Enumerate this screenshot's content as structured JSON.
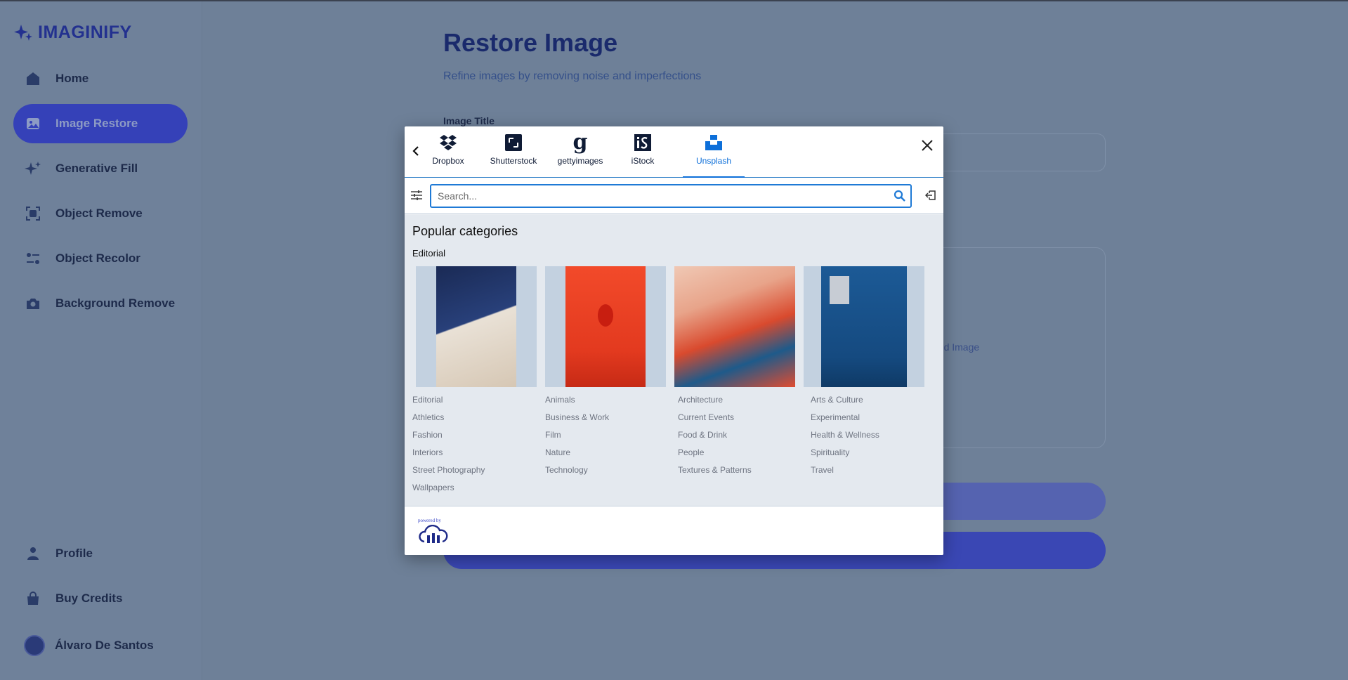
{
  "brand": {
    "name": "IMAGINIFY"
  },
  "sidebar": {
    "items": [
      {
        "label": "Home",
        "icon": "home-icon"
      },
      {
        "label": "Image Restore",
        "icon": "image-icon",
        "active": true
      },
      {
        "label": "Generative Fill",
        "icon": "sparkle-icon"
      },
      {
        "label": "Object Remove",
        "icon": "scan-icon"
      },
      {
        "label": "Object Recolor",
        "icon": "filter-icon"
      },
      {
        "label": "Background Remove",
        "icon": "camera-icon"
      }
    ],
    "bottom_items": [
      {
        "label": "Profile",
        "icon": "person-icon"
      },
      {
        "label": "Buy Credits",
        "icon": "bag-icon"
      }
    ],
    "user_name": "Álvaro De Santos"
  },
  "main": {
    "title": "Restore Image",
    "subtitle": "Refine images by removing noise and imperfections",
    "field_label": "Image Title",
    "transformed_label": "ned Image"
  },
  "modal": {
    "tabs": [
      {
        "label": "Dropbox",
        "icon": "dropbox-icon"
      },
      {
        "label": "Shutterstock",
        "icon": "shutterstock-icon"
      },
      {
        "label": "gettyimages",
        "icon": "gettyimages-icon"
      },
      {
        "label": "iStock",
        "icon": "istock-icon"
      },
      {
        "label": "Unsplash",
        "icon": "unsplash-icon",
        "active": true
      }
    ],
    "search_placeholder": "Search...",
    "popular_title": "Popular categories",
    "section_title": "Editorial",
    "categories": [
      [
        "Editorial",
        "Athletics",
        "Fashion",
        "Interiors",
        "Street Photography",
        "Wallpapers"
      ],
      [
        "Animals",
        "Business & Work",
        "Film",
        "Nature",
        "Technology"
      ],
      [
        "Architecture",
        "Current Events",
        "Food & Drink",
        "People",
        "Textures & Patterns"
      ],
      [
        "Arts & Culture",
        "Experimental",
        "Health & Wellness",
        "Spirituality",
        "Travel"
      ]
    ],
    "powered_by": "powered by",
    "accent_color": "#0d6fd9"
  }
}
